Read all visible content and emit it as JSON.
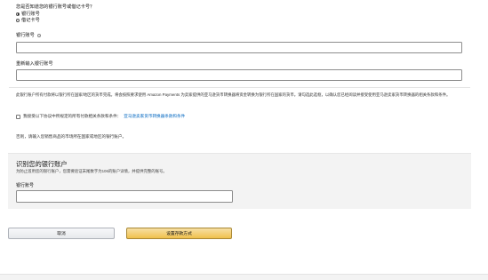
{
  "account_type": {
    "question": "您是否知道您的银行账号或借记卡号？",
    "options": [
      {
        "label": "银行账号",
        "selected": true
      },
      {
        "label": "借记卡号",
        "selected": false
      }
    ]
  },
  "fields": {
    "bank_account_label": "银行账号",
    "bank_account_info_icon": "info-icon",
    "bank_account_value": "",
    "reenter_label": "重新输入银行账号",
    "reenter_value": ""
  },
  "notice": {
    "text": "此银行账户所有付款将以银行所在国家/地区的货币完成。将会按照要求使用 Amazon Payments 为卖家提供的亚马逊货币转换器将资金转换为银行所在国家的货币。请勾选此选框，以确认您已经阅读并接受使用亚马逊卖家货币转换器的相关条款和条件。",
    "checkbox_label": "我接受以下协议中所规定的所有付款相关条款和条件：",
    "checkbox_link": "亚马逊卖家货币转换器条款和条件",
    "checkbox_checked": false,
    "footnote": "否则，请输入您销售商品的市场所在国家或地区的银行账户。"
  },
  "identify_panel": {
    "title": "识别您的银行账户",
    "subtitle": "为防止滥用您的银行账户，您需要验证末尾数字为106的账户详情，并提供完整的账号。",
    "field_label": "银行账号",
    "field_value": ""
  },
  "buttons": {
    "cancel": "取消",
    "submit": "设置存款方式"
  },
  "colors": {
    "link": "#0066c0",
    "primary_button": "#f0c14b",
    "panel_bg": "#f3f3f3"
  }
}
